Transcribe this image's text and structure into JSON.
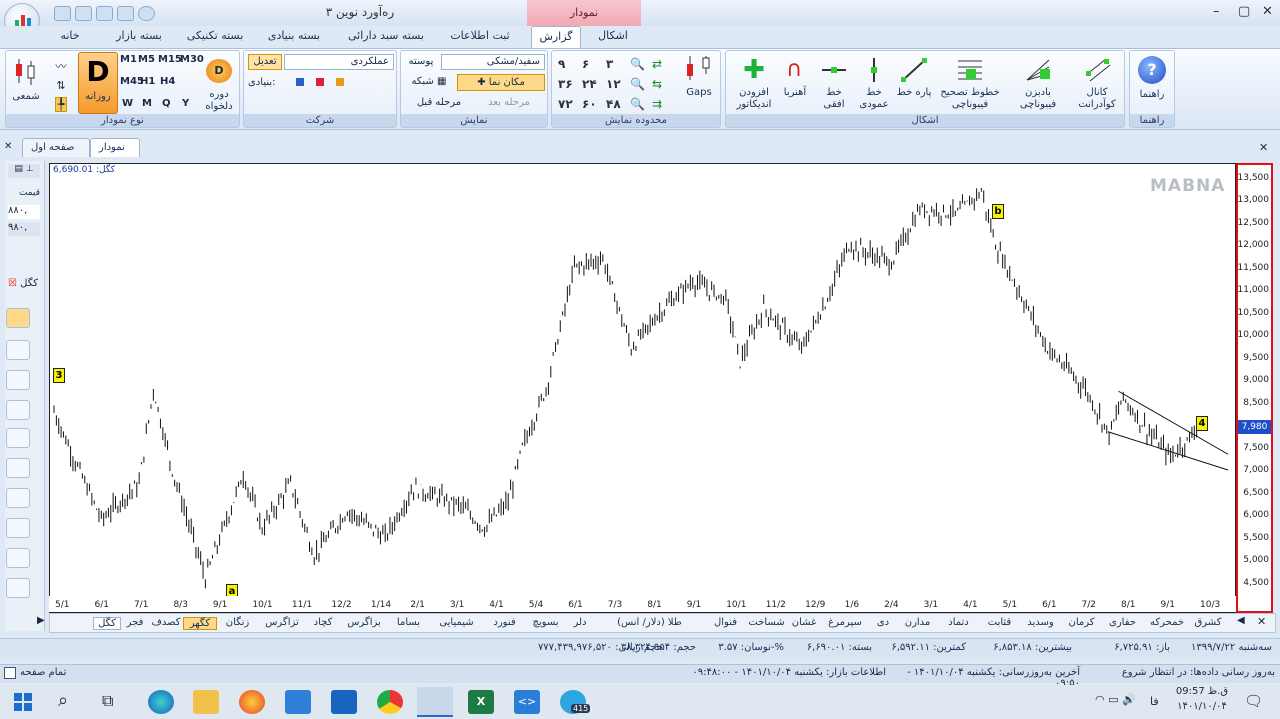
{
  "window": {
    "title": "ره‌آورد نوین ۳",
    "context_tab": "نمودار"
  },
  "menu_tabs": [
    "خانه",
    "بسته بازار",
    "بسته تکنیکی",
    "بسته بنیادی",
    "بسته سبد دارائی",
    "ثبت اطلاعات",
    "گزارش",
    "اشکال"
  ],
  "ribbon": {
    "chart_type": {
      "title": "نوع نمودار",
      "daily_big": "D",
      "daily_label": "روزانه",
      "candle_label": "شمعی",
      "period_label": "دوره دلخواه",
      "periods": [
        "M1",
        "M5",
        "M15",
        "M30",
        "M45",
        "H1",
        "H4",
        "W",
        "M",
        "Q",
        "Y"
      ]
    },
    "company": {
      "title": "شرکت",
      "company_name": "عملکردی",
      "adjust": "تعدیل",
      "fundamental": "بنیادی:"
    },
    "display": {
      "title": "نمایش",
      "theme": "سفید/مشکی",
      "skin": "پوسته",
      "cursor": "مکان نما",
      "grid": "شبکه",
      "next": "مرحله بعد",
      "prev": "مرحله قبل"
    },
    "range": {
      "title": "محدوده نمایش",
      "buttons": [
        "۳",
        "۶",
        "۹",
        "۱۲",
        "۲۴",
        "۳۶",
        "۴۸",
        "۶۰",
        "۷۲"
      ],
      "gaps": "Gaps"
    },
    "shapes": {
      "title": "اشکال",
      "items": [
        "افزودن اندیکاتور",
        "آهنربا",
        "خط افقی",
        "خط عمودی",
        "پاره خط",
        "خطوط تصحیح فیبوناچی",
        "بادبزن فیبوناچی",
        "کانال کوآدرانت"
      ]
    },
    "help": {
      "title": "راهنما",
      "label": "راهنما"
    }
  },
  "chart_tabs": [
    "نمودار",
    "صفحه اول"
  ],
  "chart": {
    "symbol": "کگل",
    "last_value": "6,690.01",
    "watermark": "MABNA",
    "price_tag": "7,980",
    "markers": {
      "a": "a",
      "b": "b",
      "three": "3",
      "four": "4"
    }
  },
  "left_panel": {
    "price_label": "قیمت",
    "v1": "۸۸۰,",
    "v2": "۹۸۰,",
    "sym": "کگل"
  },
  "chart_data": {
    "type": "ohlc",
    "symbol": "کگل",
    "y_ticks": [
      13500,
      13000,
      12500,
      12000,
      11500,
      11000,
      10500,
      10000,
      9500,
      9000,
      8500,
      8000,
      7500,
      7000,
      6500,
      6000,
      5500,
      5000,
      4500
    ],
    "ylim": [
      4200,
      13800
    ],
    "x_ticks": [
      "5/1",
      "6/1",
      "7/1",
      "8/3",
      "9/1",
      "10/1",
      "11/1",
      "12/2",
      "1/14",
      "2/1",
      "3/1",
      "4/1",
      "5/4",
      "6/1",
      "7/3",
      "8/1",
      "9/1",
      "10/1",
      "11/2",
      "12/9",
      "1/6",
      "2/4",
      "3/1",
      "4/1",
      "5/1",
      "6/1",
      "7/2",
      "8/1",
      "9/1",
      "10/3"
    ],
    "price_points": [
      [
        0,
        8300
      ],
      [
        4,
        7300
      ],
      [
        10,
        5900
      ],
      [
        18,
        6700
      ],
      [
        21,
        8800
      ],
      [
        25,
        7000
      ],
      [
        32,
        4600
      ],
      [
        40,
        6900
      ],
      [
        44,
        5700
      ],
      [
        50,
        6700
      ],
      [
        55,
        5100
      ],
      [
        62,
        6100
      ],
      [
        70,
        5500
      ],
      [
        76,
        6600
      ],
      [
        86,
        6200
      ],
      [
        91,
        5700
      ],
      [
        96,
        6300
      ],
      [
        99,
        7500
      ],
      [
        104,
        8800
      ],
      [
        110,
        11500
      ],
      [
        116,
        11700
      ],
      [
        122,
        9700
      ],
      [
        128,
        10500
      ],
      [
        135,
        11200
      ],
      [
        142,
        10800
      ],
      [
        145,
        9400
      ],
      [
        150,
        10600
      ],
      [
        158,
        9700
      ],
      [
        163,
        10700
      ],
      [
        168,
        12000
      ],
      [
        177,
        11600
      ],
      [
        183,
        12800
      ],
      [
        191,
        12700
      ],
      [
        196,
        13200
      ],
      [
        199,
        12000
      ],
      [
        210,
        9700
      ],
      [
        218,
        8800
      ],
      [
        223,
        7800
      ],
      [
        226,
        8600
      ],
      [
        231,
        7900
      ],
      [
        236,
        7300
      ],
      [
        240,
        7700
      ],
      [
        242,
        8100
      ]
    ],
    "last_price": "7,980"
  },
  "symbols": [
    "کشرق",
    "خمحرکه",
    "حفاری",
    "کرمان",
    "وسدید",
    "قثابت",
    "دتماد",
    "مدارن",
    "دی",
    "سپرمرغ",
    "غشان",
    "شساخت",
    "فنوال",
    "طلا (دلار/ انس)",
    "دلر",
    "بسویچ",
    "فنورد",
    "شیمیایی",
    "بساما",
    "بزاگرس",
    "کچاد",
    "تزاگرس",
    "زنگان",
    "کگهر",
    "کصدف",
    "فجر",
    "کگل"
  ],
  "info": {
    "date": "سه‌شنبه ۱۳۹۹/۷/۲۲",
    "open": "باز: ۶,۷۲۵.۹۱",
    "high": "بیشترین: ۶,۸۵۳.۱۸",
    "low": "کمترین: ۶,۵۹۲.۱۱",
    "close": "بسته: ۶,۶۹۰.۰۱",
    "change": "نوسان: ۳.۵۷-%",
    "volume": "حجم: ۳۸,۳۲۴,۹۵۴",
    "value": "حجم ریالی: ۷۷۷,۴۳۹,۹۷۶,۵۲۰"
  },
  "status": {
    "left": "تمام صفحه",
    "update": "به‌روز رسانی داده‌ها: در انتظار شروع",
    "last": "آخرین به‌روزرسانی: یکشنبه ۱۴۰۱/۱۰/۰۴ - ۰۹:۵۰",
    "market": "اطلاعات بازار: یکشنبه ۱۴۰۱/۱۰/۰۴ - ۰۹:۴۸:۰۰"
  },
  "taskbar": {
    "time": "09:57 ق.ظ",
    "date": "۱۴۰۱/۱۰/۰۴",
    "lang": "فا",
    "badge": "415"
  }
}
